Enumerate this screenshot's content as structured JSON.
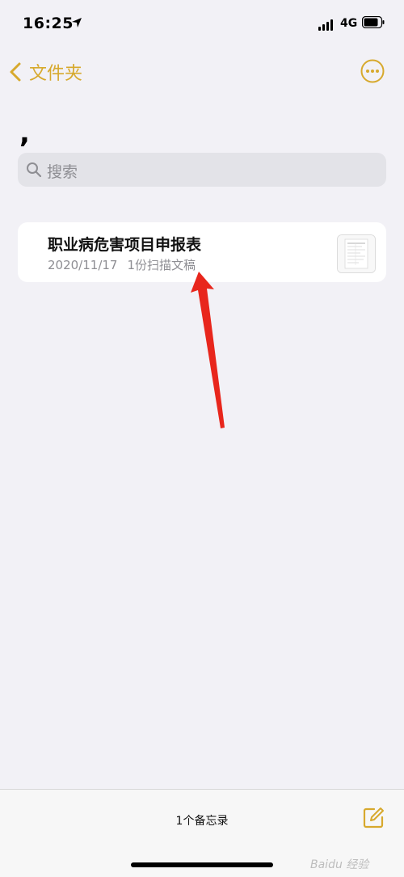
{
  "status_bar": {
    "time": "16:25",
    "network": "4G"
  },
  "nav": {
    "back_label": "文件夹",
    "more_icon": "ellipsis-circle-icon"
  },
  "folder": {
    "title": ","
  },
  "search": {
    "placeholder": "搜索"
  },
  "notes": [
    {
      "title": "职业病危害项目申报表",
      "date": "2020/11/17",
      "attachment": "1份扫描文稿"
    }
  ],
  "toolbar": {
    "note_count": "1个备忘录",
    "compose_icon": "compose-icon"
  },
  "watermark": "Baidu 经验",
  "colors": {
    "accent": "#d7a92d",
    "background": "#f2f1f6",
    "arrow": "#e8261c"
  }
}
